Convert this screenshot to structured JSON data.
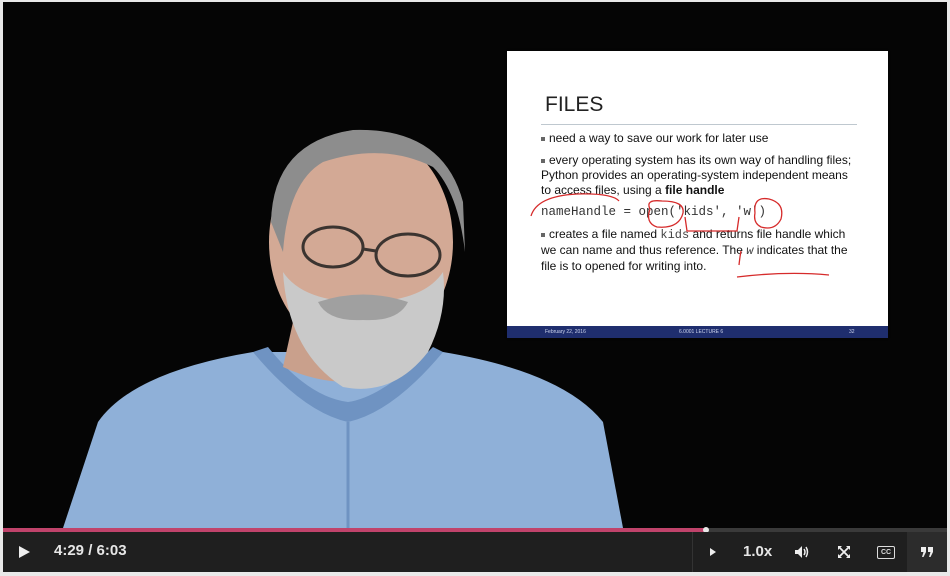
{
  "slide": {
    "title": "FILES",
    "bullets": [
      "need a way to save our work for later use",
      "every operating system has its own way of handling files; Python provides an operating-system independent means to access files, using a ",
      "creates a file named "
    ],
    "bold_term": "file handle",
    "code_line": "nameHandle = open('kids', 'w')",
    "bullet3_code": "kids",
    "bullet3_rest": " and returns file handle which we can name and thus reference.  The ",
    "bullet3_w": "w",
    "bullet3_end": " indicates that the file is to opened for writing into.",
    "footer_left": "February 22, 2016",
    "footer_center": "6.0001 LECTURE 6",
    "footer_right": "32"
  },
  "player": {
    "current_time": "4:29",
    "separator": " / ",
    "duration": "6:03",
    "progress": 0.745,
    "speed": "1.0x",
    "cc_label": "CC",
    "accent_color": "#c0436b"
  }
}
